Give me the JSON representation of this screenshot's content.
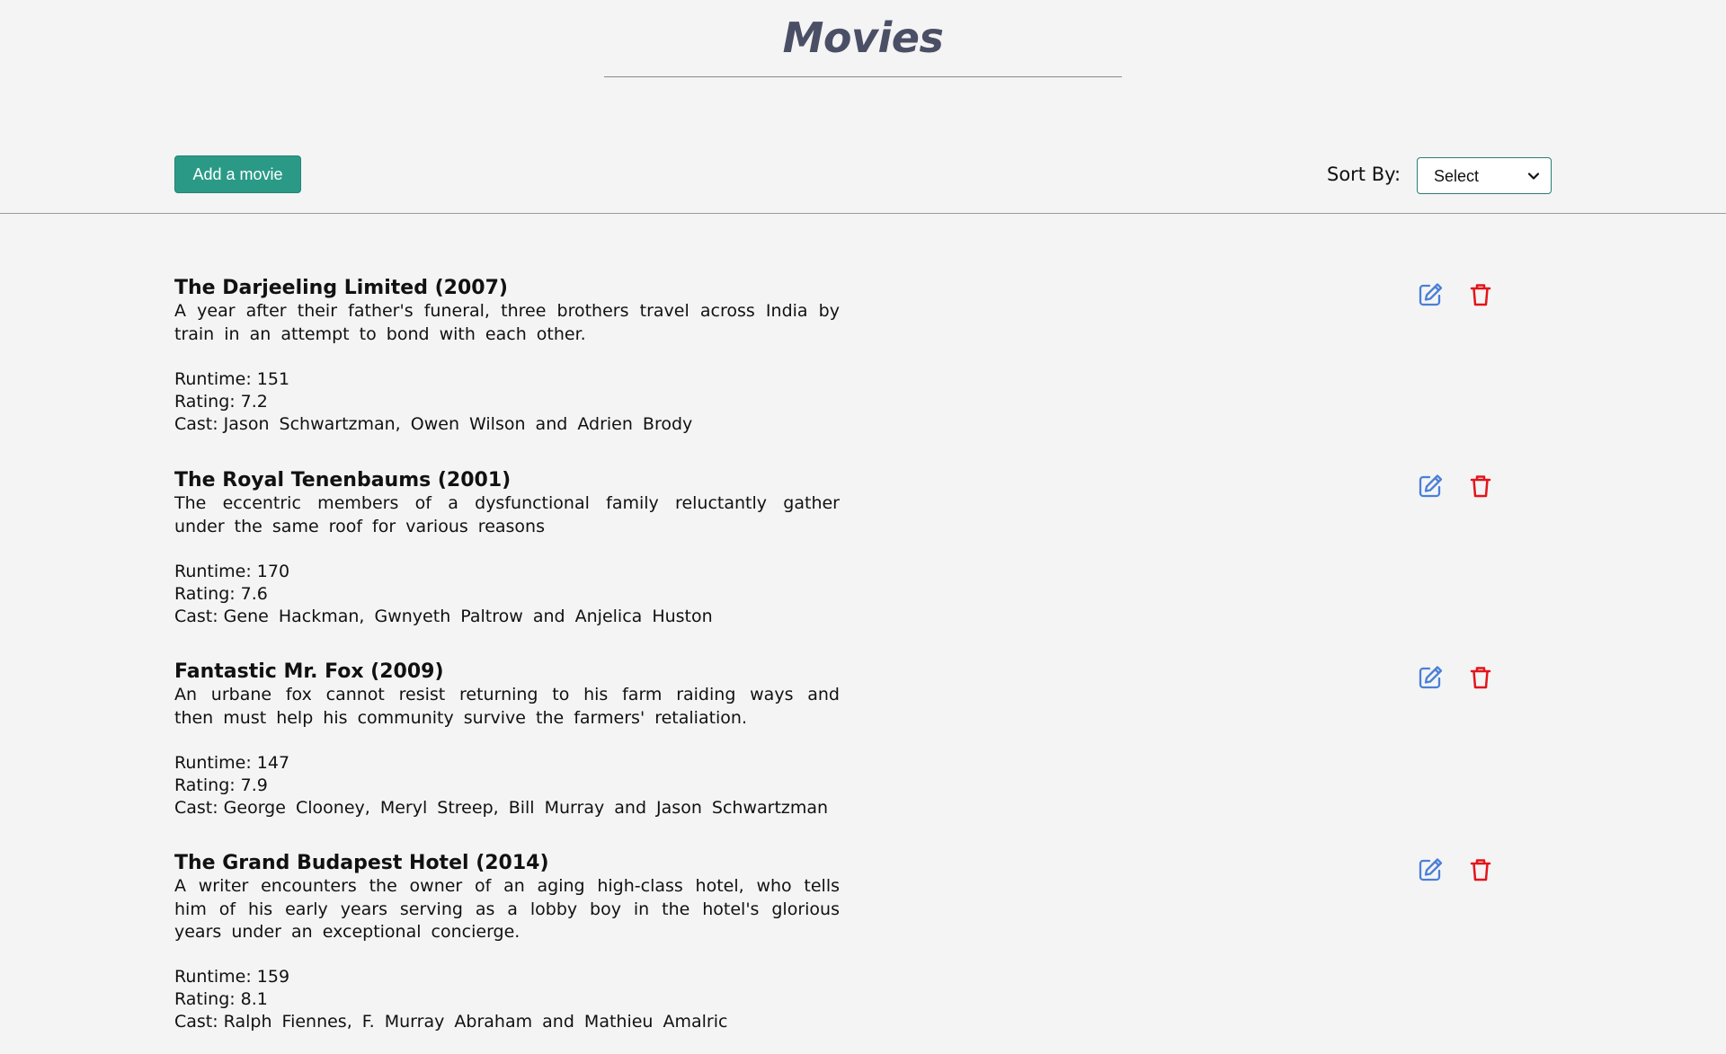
{
  "header": {
    "title": "Movies"
  },
  "toolbar": {
    "add_label": "Add a movie",
    "sort_label": "Sort By:",
    "sort_value": "Select"
  },
  "icons": {
    "edit": "edit-icon",
    "delete": "trash-icon",
    "chevron": "chevron-down-icon"
  },
  "colors": {
    "title": "#4b4f66",
    "add_button": "#2a9a87",
    "edit_icon": "#4a7fd9",
    "delete_icon": "#e3141b",
    "select_border": "#2a7d73"
  },
  "labels": {
    "runtime": "Runtime:",
    "rating": "Rating:",
    "cast": "Cast:"
  },
  "movies": [
    {
      "title": "The Darjeeling Limited (2007)",
      "description": "A year after their father's funeral, three brothers travel across India by train in an attempt to bond with each other.",
      "runtime": "151",
      "rating": "7.2",
      "cast": "Jason Schwartzman, Owen Wilson and Adrien Brody"
    },
    {
      "title": "The Royal Tenenbaums (2001)",
      "description": "The eccentric members of a dysfunctional family reluctantly gather under the same roof for various reasons",
      "runtime": "170",
      "rating": "7.6",
      "cast": "Gene Hackman, Gwnyeth Paltrow and Anjelica Huston"
    },
    {
      "title": "Fantastic Mr. Fox (2009)",
      "description": "An urbane fox cannot resist returning to his farm raiding ways and then must help his community survive the farmers' retaliation.",
      "runtime": "147",
      "rating": "7.9",
      "cast": "George Clooney, Meryl Streep, Bill Murray and Jason Schwartzman"
    },
    {
      "title": "The Grand Budapest Hotel (2014)",
      "description": "A writer encounters the owner of an aging high-class hotel, who tells him of his early years serving as a lobby boy in the hotel's glorious years under an exceptional concierge.",
      "runtime": "159",
      "rating": "8.1",
      "cast": "Ralph Fiennes, F. Murray Abraham and Mathieu Amalric"
    }
  ]
}
